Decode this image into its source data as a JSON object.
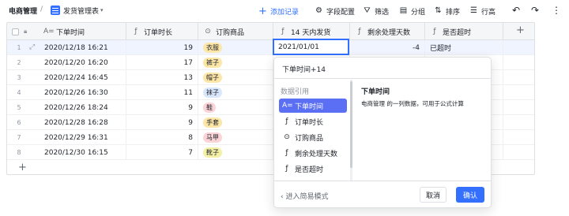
{
  "breadcrumb": {
    "root": "电商管理",
    "sep": "/",
    "sheet": "发货管理表",
    "caret": "▾"
  },
  "toolbar": {
    "add": "添加记录",
    "fields": "字段配置",
    "filter": "筛选",
    "group": "分组",
    "sort": "排序",
    "rowheight": "行高",
    "undo": "↶",
    "redo": "↷",
    "more": "⋮"
  },
  "columns": [
    {
      "label": "下单时间",
      "icon": "A="
    },
    {
      "label": "订单时长",
      "icon": "ƒ"
    },
    {
      "label": "订购商品",
      "icon": "⊙"
    },
    {
      "label": "14 天内发货",
      "icon": "ƒ"
    },
    {
      "label": "剩余处理天数",
      "icon": "ƒ"
    },
    {
      "label": "是否超时",
      "icon": "ƒ"
    }
  ],
  "rows": [
    {
      "n": "1",
      "time": "2020/12/18 16:21",
      "dur": "19",
      "item": "衣服",
      "tag_color": "#fce6a8",
      "ship": "",
      "remain": "-4",
      "over": "已超时"
    },
    {
      "n": "2",
      "time": "2020/12/20 16:20",
      "dur": "17",
      "item": "裤子",
      "tag_color": "#fce6a8",
      "ship": "",
      "remain": "",
      "over": ""
    },
    {
      "n": "3",
      "time": "2020/12/24 16:45",
      "dur": "13",
      "item": "帽子",
      "tag_color": "#fce6a8",
      "ship": "",
      "remain": "",
      "over": ""
    },
    {
      "n": "4",
      "time": "2020/12/26 16:30",
      "dur": "11",
      "item": "袜子",
      "tag_color": "#d9e7fd",
      "ship": "",
      "remain": "",
      "over": ""
    },
    {
      "n": "5",
      "time": "2020/12/26 18:24",
      "dur": "9",
      "item": "鞋",
      "tag_color": "#fbd4d8",
      "ship": "",
      "remain": "",
      "over": ""
    },
    {
      "n": "6",
      "time": "2020/12/28 16:28",
      "dur": "9",
      "item": "手套",
      "tag_color": "#fce6a8",
      "ship": "",
      "remain": "",
      "over": ""
    },
    {
      "n": "7",
      "time": "2020/12/29 16:31",
      "dur": "8",
      "item": "马甲",
      "tag_color": "#fbd4d8",
      "ship": "",
      "remain": "",
      "over": ""
    },
    {
      "n": "8",
      "time": "2020/12/30 16:15",
      "dur": "7",
      "item": "靴子",
      "tag_color": "#f4f0a6",
      "ship": "",
      "remain": "",
      "over": ""
    }
  ],
  "active_cell_value": "2021/01/01",
  "popup": {
    "formula": "下单时间+14",
    "refs_title": "数据引用",
    "refs": [
      {
        "label": "下单时间",
        "icon": "A="
      },
      {
        "label": "订单时长",
        "icon": "ƒ"
      },
      {
        "label": "订购商品",
        "icon": "⊙"
      },
      {
        "label": "剩余处理天数",
        "icon": "ƒ"
      },
      {
        "label": "是否超时",
        "icon": "ƒ"
      }
    ],
    "detail_title": "下单时间",
    "detail_desc": "电商管理 的一列数据，可用于公式计算",
    "simple_mode": "‹  进入简易模式",
    "cancel": "取消",
    "confirm": "确认"
  },
  "colors": {
    "accent": "#3370ff",
    "ref_active": "#5b6ff5"
  }
}
